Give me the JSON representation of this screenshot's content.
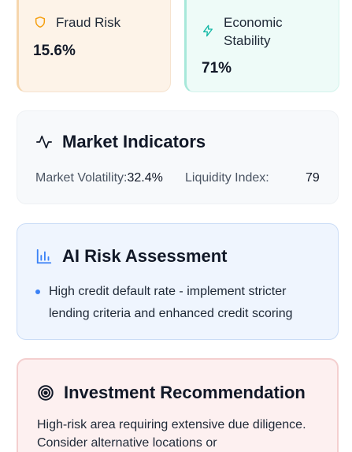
{
  "metrics": {
    "fraud": {
      "label": "Fraud Risk",
      "value": "15.6%",
      "icon": "shield-icon",
      "color": "#f59e0b"
    },
    "economic": {
      "label": "Economic Stability",
      "value": "71%",
      "icon": "lightning-icon",
      "color": "#14b8a6"
    }
  },
  "market": {
    "title": "Market Indicators",
    "icon": "activity-icon",
    "volatility_label": "Market Volatility:",
    "volatility_value": "32.4%",
    "liquidity_label": "Liquidity Index:",
    "liquidity_value": "79"
  },
  "ai_assessment": {
    "title": "AI Risk Assessment",
    "icon": "bar-chart-icon",
    "items": [
      "High credit default rate - implement stricter lending criteria and enhanced credit scoring"
    ]
  },
  "investment": {
    "title": "Investment Recommendation",
    "icon": "target-icon",
    "text": "High-risk area requiring extensive due diligence. Consider alternative locations or"
  }
}
